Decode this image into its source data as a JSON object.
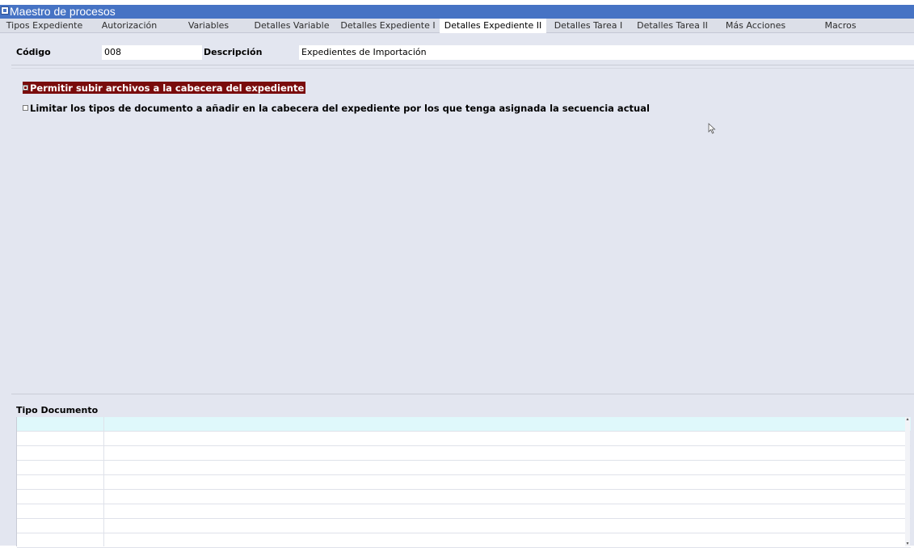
{
  "window": {
    "title": "Maestro de procesos"
  },
  "tabs": [
    {
      "label": "Tipos Expediente",
      "active": false
    },
    {
      "label": "Autorización",
      "active": false
    },
    {
      "label": "Variables",
      "active": false
    },
    {
      "label": "Detalles Variable",
      "active": false
    },
    {
      "label": "Detalles Expediente I",
      "active": false
    },
    {
      "label": "Detalles Expediente II",
      "active": true
    },
    {
      "label": "Detalles Tarea I",
      "active": false
    },
    {
      "label": "Detalles Tarea II",
      "active": false
    },
    {
      "label": "Más Acciones",
      "active": false
    },
    {
      "label": "Macros",
      "active": false
    }
  ],
  "header": {
    "codigo_label": "Código",
    "codigo_value": "008",
    "descripcion_label": "Descripción",
    "descripcion_value": "Expedientes de Importación"
  },
  "options": [
    {
      "label": "Permitir subir archivos a la cabecera del expediente",
      "checked": true
    },
    {
      "label": "Limitar los tipos de documento a añadir en la cabecera del expediente por los que tenga asignada la secuencia actual",
      "checked": false
    }
  ],
  "grid": {
    "title": "Tipo Documento",
    "rows": [
      "",
      "",
      "",
      "",
      "",
      "",
      "",
      "",
      ""
    ]
  },
  "colors": {
    "titlebar": "#4673c4",
    "selected_option": "#7a0c0c",
    "first_row": "#dff8fb"
  }
}
